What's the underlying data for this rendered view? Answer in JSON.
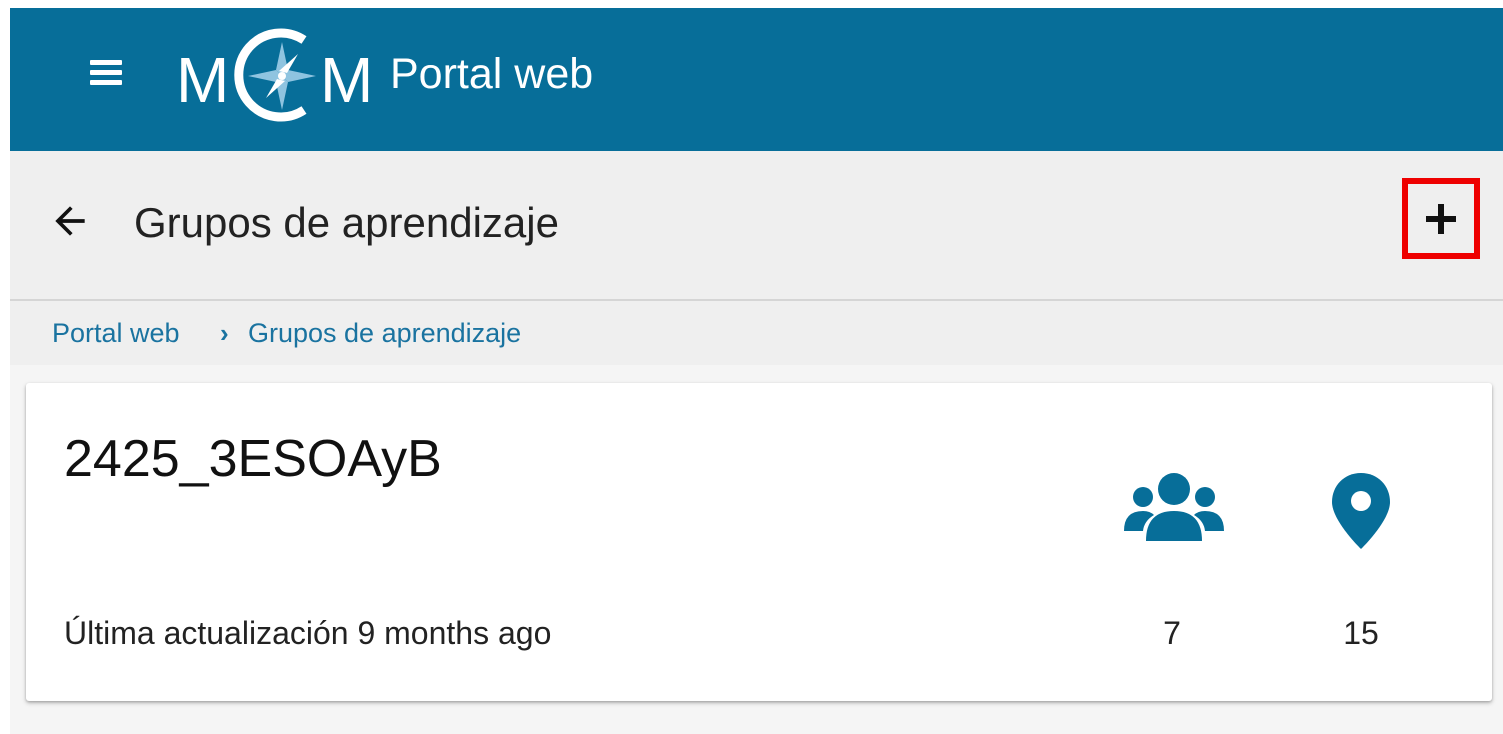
{
  "colors": {
    "primary": "#076e99",
    "highlight_box": "#ee0000",
    "link": "#1a73a0"
  },
  "appbar": {
    "menu_icon": "hamburger-menu-icon",
    "logo_icon": "mcm-compass-logo",
    "title": "Portal web"
  },
  "toolbar": {
    "back_icon": "arrow-left-icon",
    "title": "Grupos de aprendizaje",
    "add_icon": "plus-icon"
  },
  "breadcrumb": {
    "items": [
      "Portal web",
      "Grupos de aprendizaje"
    ],
    "separator": "›"
  },
  "groups": [
    {
      "name": "2425_3ESOAyB",
      "updated": "Última actualización 9 months ago",
      "members_icon": "people-group-icon",
      "members_count": "7",
      "locations_icon": "map-pin-icon",
      "locations_count": "15"
    }
  ]
}
